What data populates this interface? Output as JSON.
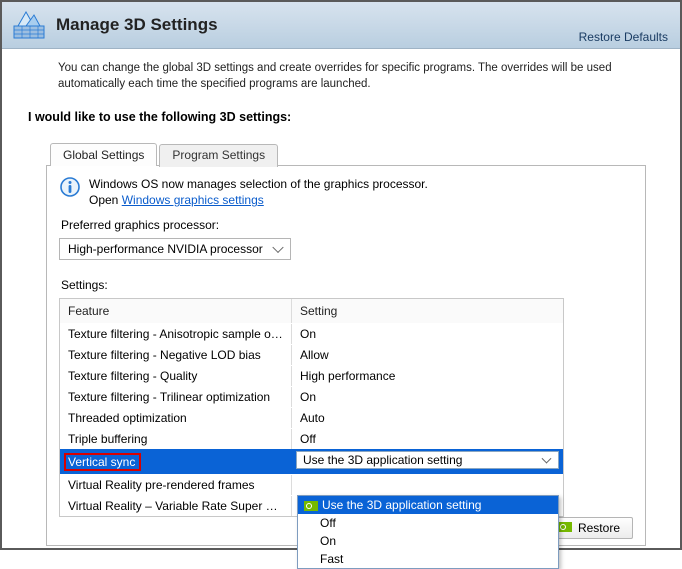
{
  "header": {
    "title": "Manage 3D Settings",
    "restore_link": "Restore Defaults"
  },
  "intro": "You can change the global 3D settings and create overrides for specific programs. The overrides will be used automatically each time the specified programs are launched.",
  "section_label": "I would like to use the following 3D settings:",
  "tabs": {
    "global": "Global Settings",
    "program": "Program Settings"
  },
  "info": {
    "line1": "Windows OS now manages selection of the graphics processor.",
    "line2_prefix": "Open ",
    "line2_link": "Windows graphics settings"
  },
  "preferred_label": "Preferred graphics processor:",
  "preferred_value": "High-performance NVIDIA processor",
  "settings_label": "Settings:",
  "table": {
    "head_feature": "Feature",
    "head_setting": "Setting",
    "rows": [
      {
        "feature": "Texture filtering - Anisotropic sample opti...",
        "setting": "On"
      },
      {
        "feature": "Texture filtering - Negative LOD bias",
        "setting": "Allow"
      },
      {
        "feature": "Texture filtering - Quality",
        "setting": "High performance"
      },
      {
        "feature": "Texture filtering - Trilinear optimization",
        "setting": "On"
      },
      {
        "feature": "Threaded optimization",
        "setting": "Auto"
      },
      {
        "feature": "Triple buffering",
        "setting": "Off"
      },
      {
        "feature": "Vertical sync",
        "setting": "Use the 3D application setting",
        "selected": true
      },
      {
        "feature": "Virtual Reality pre-rendered frames",
        "setting": ""
      },
      {
        "feature": "Virtual Reality – Variable Rate Super Samp...",
        "setting": ""
      }
    ]
  },
  "dropdown": {
    "options": [
      "Use the 3D application setting",
      "Off",
      "On",
      "Fast"
    ]
  },
  "restore_btn": "Restore"
}
